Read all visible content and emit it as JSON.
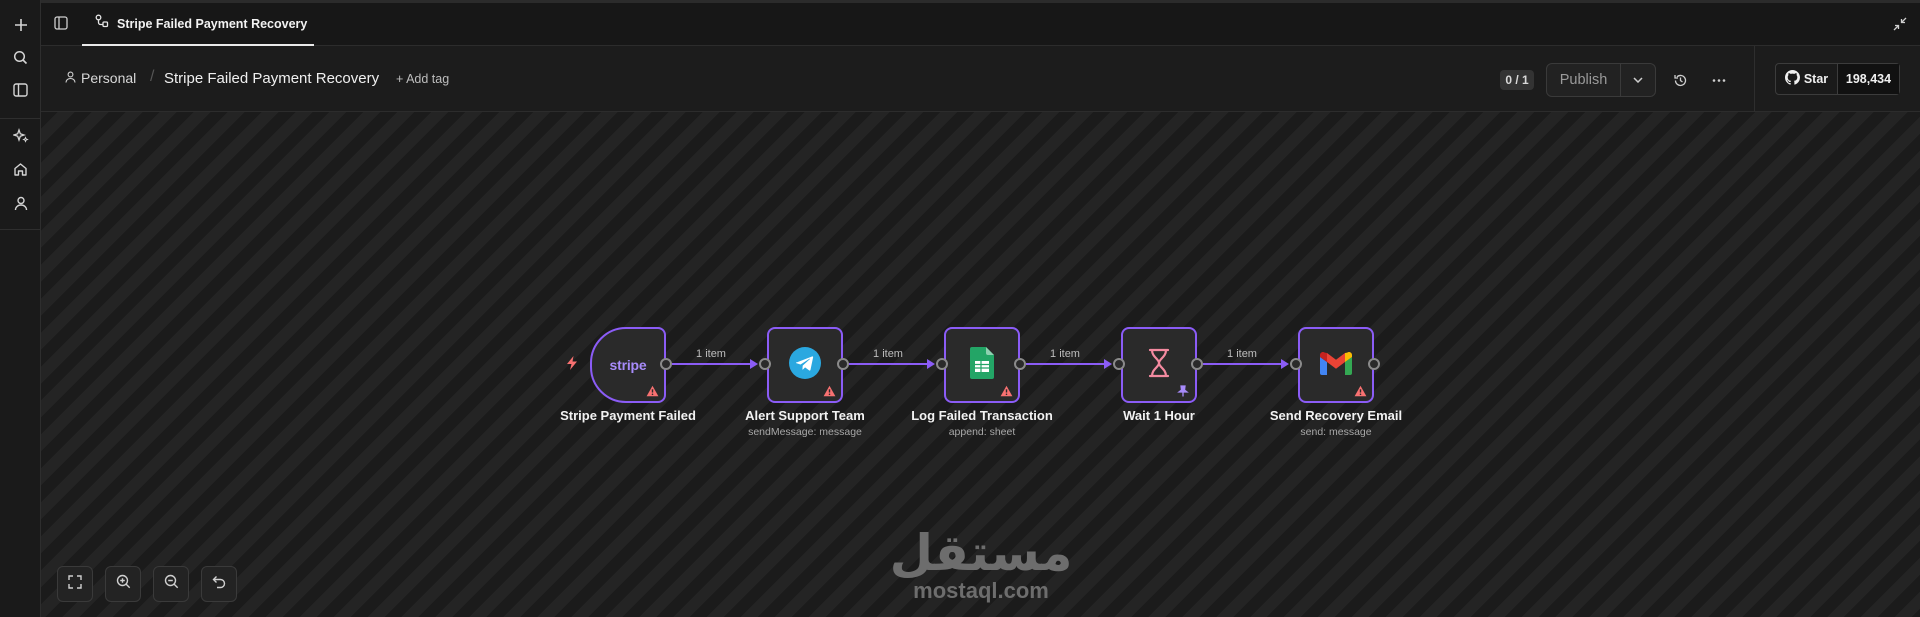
{
  "tab": {
    "title": "Stripe Failed Payment Recovery"
  },
  "header": {
    "project": "Personal",
    "workflow_title": "Stripe Failed Payment Recovery",
    "add_tag": "+ Add tag",
    "counter": "0 / 1",
    "publish": "Publish",
    "github_star": "Star",
    "github_count": "198,434"
  },
  "nodes": [
    {
      "title": "Stripe Payment Failed",
      "subtitle": "",
      "icon": "stripe-logo",
      "logo_text": "stripe",
      "warning": true
    },
    {
      "title": "Alert Support Team",
      "subtitle": "sendMessage: message",
      "icon": "telegram-icon",
      "warning": true
    },
    {
      "title": "Log Failed Transaction",
      "subtitle": "append: sheet",
      "icon": "google-sheets-icon",
      "warning": true
    },
    {
      "title": "Wait 1 Hour",
      "subtitle": "",
      "icon": "hourglass-icon",
      "warning": false,
      "pinned": true
    },
    {
      "title": "Send Recovery Email",
      "subtitle": "send: message",
      "icon": "gmail-icon",
      "warning": true
    }
  ],
  "edges": [
    {
      "label": "1 item"
    },
    {
      "label": "1 item"
    },
    {
      "label": "1 item"
    },
    {
      "label": "1 item"
    }
  ],
  "watermark": {
    "arabic": "مستقل",
    "latin": "mostaql.com"
  },
  "colors": {
    "accent": "#8b5cf6",
    "warning": "#f87171",
    "background": "#1f1f1f"
  }
}
